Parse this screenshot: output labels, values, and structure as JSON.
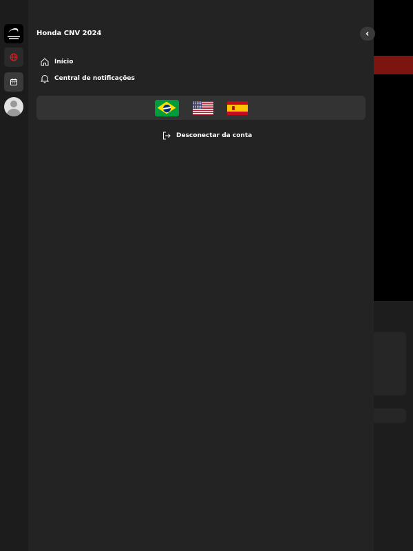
{
  "drawer": {
    "title": "Honda CNV 2024",
    "nav": [
      {
        "label": "Início",
        "icon": "home-icon"
      },
      {
        "label": "Central de notificações",
        "icon": "bell-icon"
      }
    ],
    "languages": [
      {
        "code": "pt-BR",
        "icon": "flag-brazil-icon"
      },
      {
        "code": "en-US",
        "icon": "flag-usa-icon"
      },
      {
        "code": "es",
        "icon": "flag-spain-icon"
      }
    ],
    "logout_label": "Desconectar da conta"
  },
  "rail": {
    "items": [
      {
        "icon": "honda-logo-icon"
      },
      {
        "icon": "globe-icon",
        "active": true
      },
      {
        "icon": "calendar-icon"
      },
      {
        "icon": "avatar-icon"
      }
    ]
  },
  "colors": {
    "accent": "#e02020",
    "drawer_bg": "#232323",
    "rail_bg": "#1c1c1c"
  }
}
